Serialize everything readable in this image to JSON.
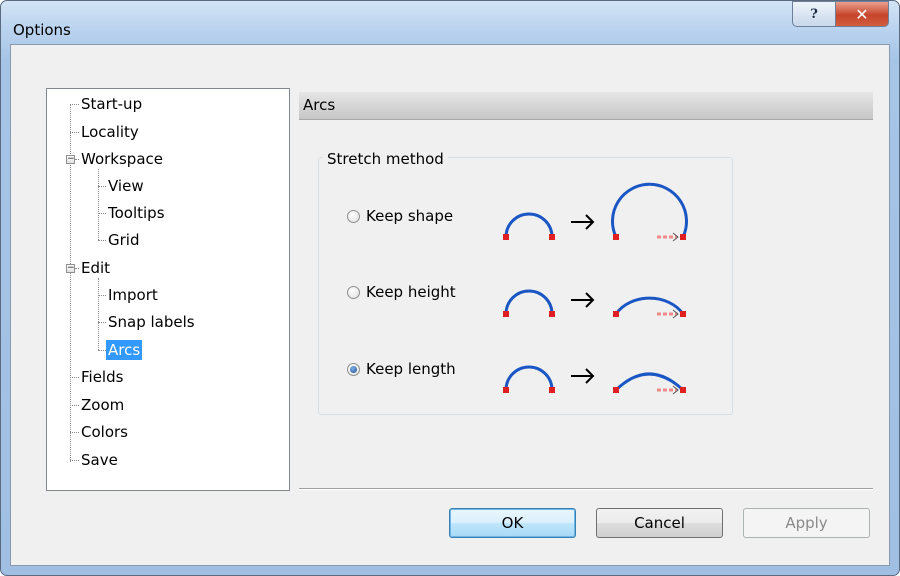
{
  "window": {
    "title": "Options",
    "help_glyph": "?",
    "close_glyph": "✕"
  },
  "tree": {
    "items": [
      {
        "label": "Start-up"
      },
      {
        "label": "Locality"
      },
      {
        "label": "Workspace"
      },
      {
        "label": "View"
      },
      {
        "label": "Tooltips"
      },
      {
        "label": "Grid"
      },
      {
        "label": "Edit"
      },
      {
        "label": "Import"
      },
      {
        "label": "Snap labels"
      },
      {
        "label": "Arcs"
      },
      {
        "label": "Fields"
      },
      {
        "label": "Zoom"
      },
      {
        "label": "Colors"
      },
      {
        "label": "Save"
      }
    ],
    "selected": "Arcs",
    "expander_glyph": "−"
  },
  "panel": {
    "header": "Arcs",
    "group_label": "Stretch method",
    "options": [
      {
        "label": "Keep shape",
        "checked": false
      },
      {
        "label": "Keep height",
        "checked": false
      },
      {
        "label": "Keep length",
        "checked": true
      }
    ]
  },
  "buttons": {
    "ok": "OK",
    "cancel": "Cancel",
    "apply": "Apply"
  },
  "colors": {
    "arc": "#1a56c4",
    "endpoint": "#e02020",
    "selection": "#3399ff"
  }
}
